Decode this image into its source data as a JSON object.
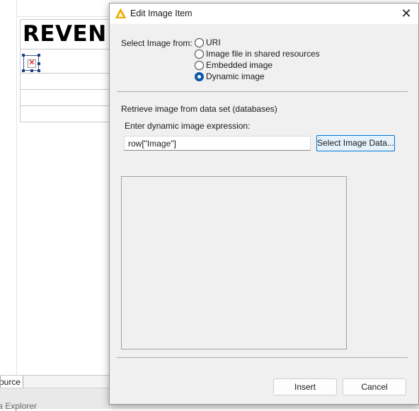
{
  "editor": {
    "report_title": "REVEN",
    "tabs": {
      "source": "ource"
    },
    "explorer_label": "a Explorer"
  },
  "dialog": {
    "title": "Edit Image Item",
    "source_label": "Select Image from:",
    "options": [
      {
        "label": "URI",
        "selected": false
      },
      {
        "label": "Image file in shared resources",
        "selected": false
      },
      {
        "label": "Embedded image",
        "selected": false
      },
      {
        "label": "Dynamic image",
        "selected": true
      }
    ],
    "group_label": "Retrieve image from data set (databases)",
    "expression_label": "Enter dynamic image expression:",
    "expression_value": "row[\"Image\"]",
    "select_data_button": "Select Image Data...",
    "insert_button": "Insert",
    "cancel_button": "Cancel"
  },
  "icons": {
    "app": "app-logo-icon",
    "close": "close-icon",
    "broken_image": "broken-image-icon"
  },
  "colors": {
    "accent": "#0078d7",
    "radio_selected": "#0a58a8",
    "dialog_bg": "#f0f0f0",
    "app_icon": "#f5b400"
  }
}
